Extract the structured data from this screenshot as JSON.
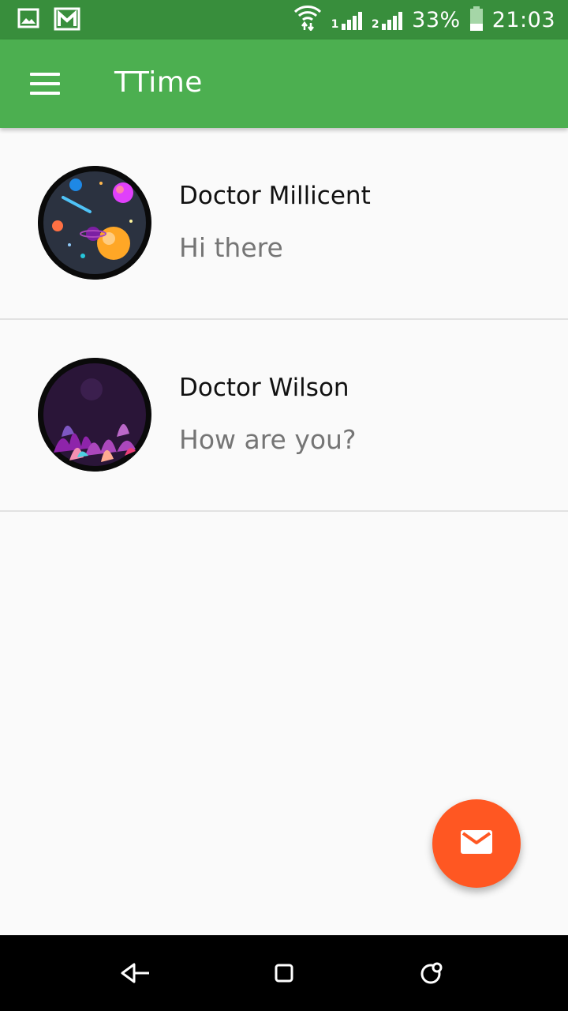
{
  "status_bar": {
    "battery_percent": "33%",
    "battery_level": 0.33,
    "time": "21:03",
    "sim1_label": "1",
    "sim2_label": "2",
    "icons": [
      "gallery-icon",
      "gmail-icon",
      "wifi-icon",
      "signal-icon",
      "signal-icon",
      "battery-icon"
    ]
  },
  "app_bar": {
    "title": "TTime",
    "menu_icon": "menu-icon"
  },
  "conversations": [
    {
      "name": "Doctor Millicent",
      "message": "Hi there",
      "avatar": "space-avatar"
    },
    {
      "name": "Doctor Wilson",
      "message": "How are you?",
      "avatar": "jungle-avatar"
    }
  ],
  "fab": {
    "icon": "mail-icon"
  },
  "nav_bar": {
    "icons": [
      "back-icon",
      "home-icon",
      "recents-icon"
    ]
  },
  "colors": {
    "status_bar": "#388e3c",
    "app_bar": "#4caf50",
    "fab": "#ff5722",
    "background": "#fafafa",
    "secondary_text": "#757575"
  }
}
